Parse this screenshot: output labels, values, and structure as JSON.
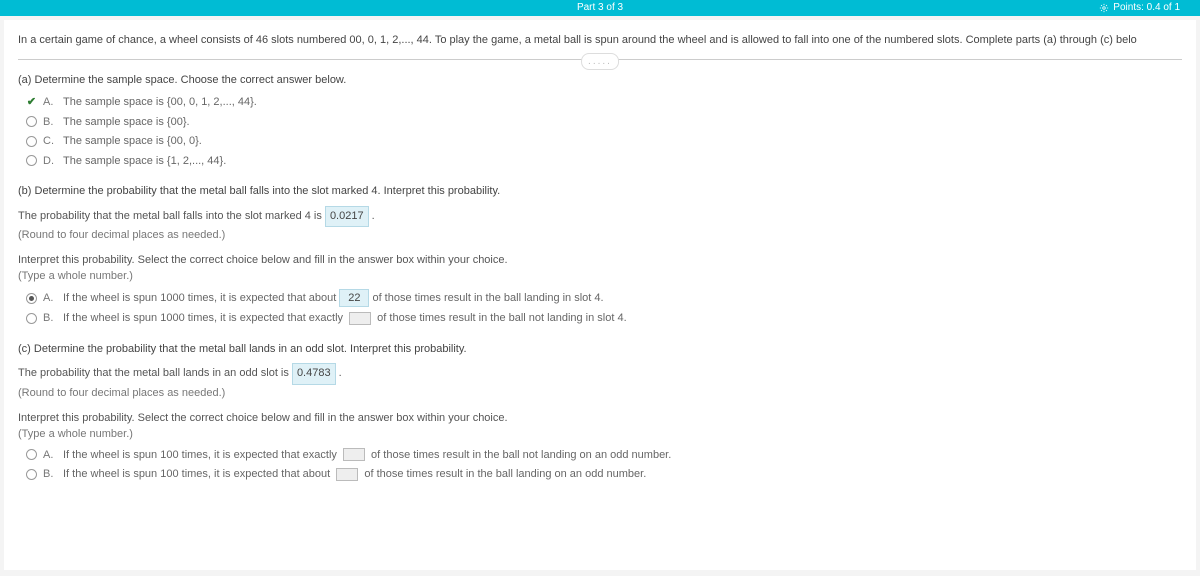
{
  "header": {
    "part": "Part 3 of 3",
    "points": "Points: 0.4 of 1"
  },
  "intro": "In a certain game of chance, a wheel consists of 46 slots numbered 00, 0, 1, 2,..., 44. To play the game, a metal ball is spun around the wheel and is allowed to fall into one of the numbered slots. Complete parts (a) through (c) belo",
  "divider_dots": ".....",
  "partA": {
    "prompt": "(a) Determine the sample space. Choose the correct answer below.",
    "options": [
      {
        "letter": "A.",
        "text": "The sample space is {00, 0, 1, 2,..., 44}."
      },
      {
        "letter": "B.",
        "text": "The sample space is {00}."
      },
      {
        "letter": "C.",
        "text": "The sample space is {00, 0}."
      },
      {
        "letter": "D.",
        "text": "The sample space is {1, 2,..., 44}."
      }
    ]
  },
  "partB": {
    "prompt": "(b) Determine the probability that the metal ball falls into the slot marked 4. Interpret this probability.",
    "line1_pre": "The probability that the metal ball falls into the slot marked 4 is ",
    "prob_value": "0.0217",
    "line1_post": " .",
    "round": "(Round to four decimal places as needed.)",
    "interpret": "Interpret this probability. Select the correct choice below and fill in the answer box within your choice.",
    "hint": "(Type a whole number.)",
    "optA": {
      "letter": "A.",
      "pre": "If the wheel is spun 1000 times, it is expected that about ",
      "val": "22",
      "post": " of those times result in the ball landing in slot 4."
    },
    "optB": {
      "letter": "B.",
      "pre": "If the wheel is spun 1000 times, it is expected that exactly ",
      "post": " of those times result in the ball not landing in slot 4."
    }
  },
  "partC": {
    "prompt": "(c) Determine the probability that the metal ball lands in an odd slot. Interpret this probability.",
    "line1_pre": "The probability that the metal ball lands in an odd slot is ",
    "prob_value": "0.4783",
    "line1_post": " .",
    "round": "(Round to four decimal places as needed.)",
    "interpret": "Interpret this probability. Select the correct choice below and fill in the answer box within your choice.",
    "hint": "(Type a whole number.)",
    "optA": {
      "letter": "A.",
      "pre": "If the wheel is spun 100 times, it is expected that exactly ",
      "post": " of those times result in the ball not landing on an odd number."
    },
    "optB": {
      "letter": "B.",
      "pre": "If the wheel is spun 100 times, it is expected that about ",
      "post": " of those times result in the ball landing on an odd number."
    }
  }
}
